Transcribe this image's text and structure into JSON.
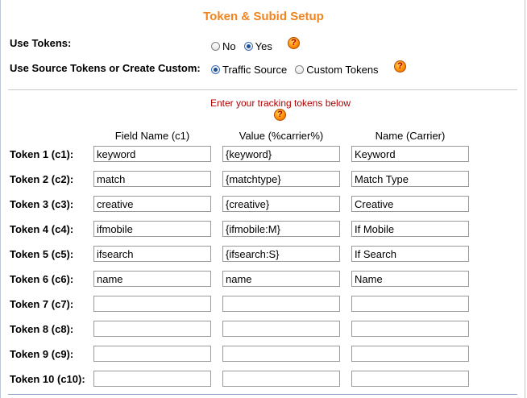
{
  "title": "Token & Subid Setup",
  "use_tokens": {
    "label": "Use Tokens:",
    "options": [
      {
        "label": "No",
        "checked": false
      },
      {
        "label": "Yes",
        "checked": true
      }
    ]
  },
  "token_source": {
    "label": "Use Source Tokens or Create Custom:",
    "options": [
      {
        "label": "Traffic Source",
        "checked": true
      },
      {
        "label": "Custom Tokens",
        "checked": false
      }
    ]
  },
  "help_icon_glyph": "?",
  "instruction": "Enter your tracking tokens below",
  "columns": {
    "field_name": "Field Name (c1)",
    "value": "Value (%carrier%)",
    "name": "Name (Carrier)"
  },
  "tokens": [
    {
      "label": "Token 1 (c1):",
      "field": "keyword",
      "value": "{keyword}",
      "name": "Keyword"
    },
    {
      "label": "Token 2 (c2):",
      "field": "match",
      "value": "{matchtype}",
      "name": "Match Type"
    },
    {
      "label": "Token 3 (c3):",
      "field": "creative",
      "value": "{creative}",
      "name": "Creative"
    },
    {
      "label": "Token 4 (c4):",
      "field": "ifmobile",
      "value": "{ifmobile:M}",
      "name": "If Mobile"
    },
    {
      "label": "Token 5 (c5):",
      "field": "ifsearch",
      "value": "{ifsearch:S}",
      "name": "If Search"
    },
    {
      "label": "Token 6 (c6):",
      "field": "name",
      "value": "name",
      "name": "Name"
    },
    {
      "label": "Token 7 (c7):",
      "field": "",
      "value": "",
      "name": ""
    },
    {
      "label": "Token 8 (c8):",
      "field": "",
      "value": "",
      "name": ""
    },
    {
      "label": "Token 9 (c9):",
      "field": "",
      "value": "",
      "name": ""
    },
    {
      "label": "Token 10 (c10):",
      "field": "",
      "value": "",
      "name": ""
    }
  ]
}
